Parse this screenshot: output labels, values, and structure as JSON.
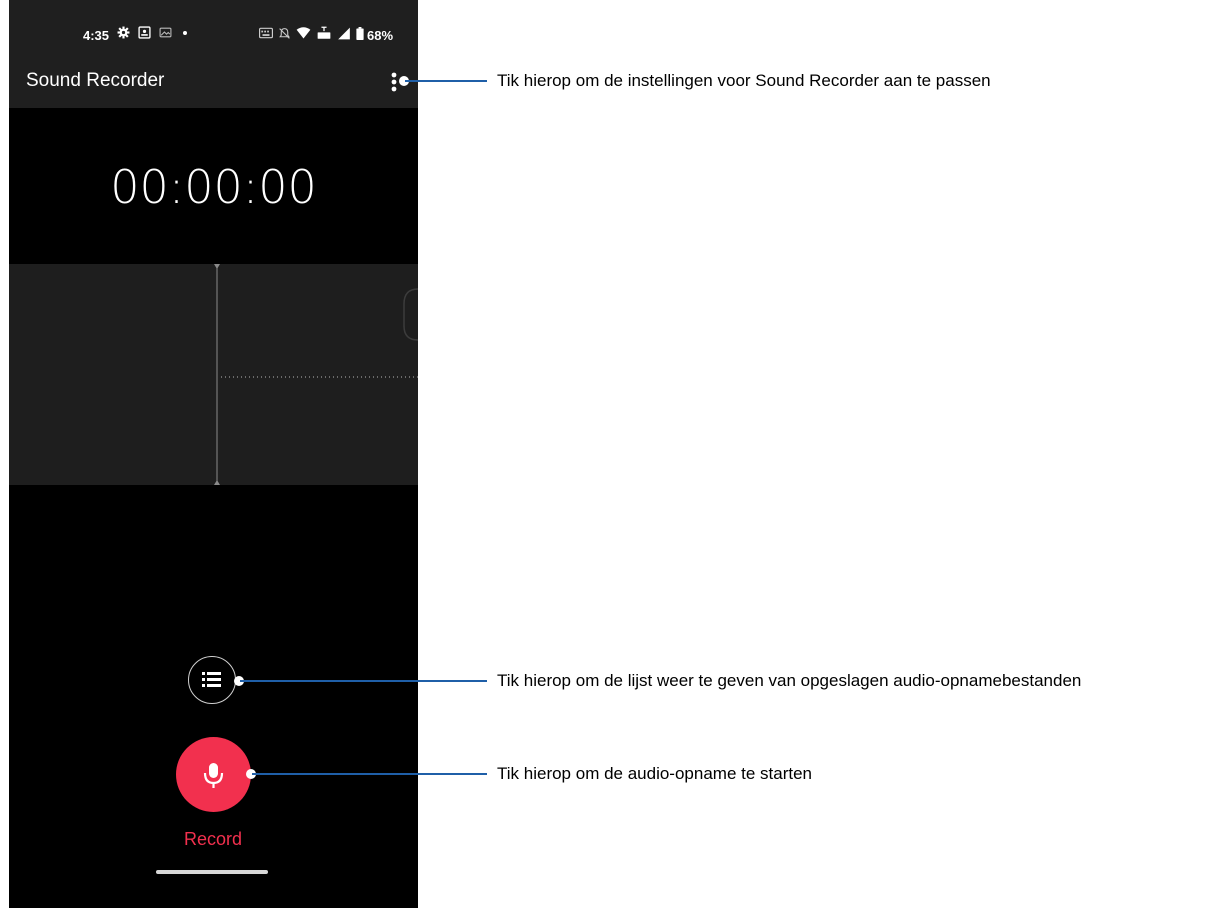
{
  "status_bar": {
    "time": "4:35",
    "battery": "68%",
    "left_icons": [
      "settings-icon",
      "screen-record-icon",
      "image-icon",
      "dot-icon"
    ],
    "right_icons": [
      "keyboard-icon",
      "silent-icon",
      "wifi-icon",
      "lte-icon",
      "signal-icon",
      "battery-icon"
    ]
  },
  "app": {
    "title": "Sound Recorder",
    "timer": "00:00:00",
    "record_label": "Record"
  },
  "callouts": {
    "settings": "Tik hierop om de instellingen voor Sound Recorder aan te passen",
    "list": "Tik hierop om de lijst weer te geven van opgeslagen audio-opnamebestanden",
    "record": "Tik hierop om de audio-opname te starten"
  },
  "colors": {
    "accent": "#f2304e",
    "callout_line": "#1f5fa8",
    "app_bar": "#1f1f1f",
    "background": "#000000"
  }
}
